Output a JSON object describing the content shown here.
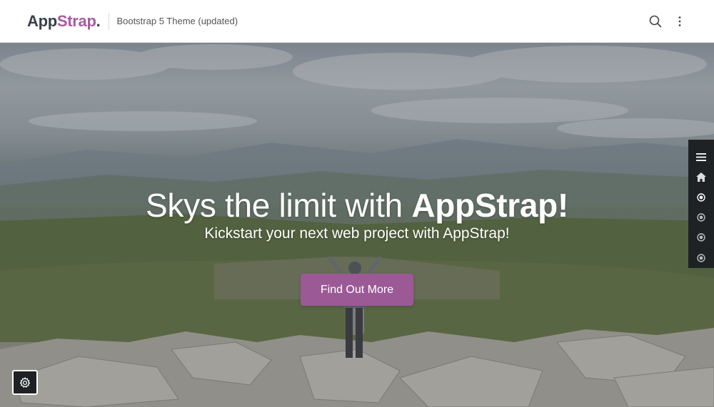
{
  "brand": {
    "part1": "App",
    "part2": "Strap",
    "part3": "."
  },
  "header": {
    "tagline": "Bootstrap 5 Theme (updated)"
  },
  "hero": {
    "headline_prefix": "Skys the limit with ",
    "headline_bold": "AppStrap!",
    "subhead": "Kickstart your next web project with AppStrap!",
    "cta_label": "Find Out More"
  },
  "sidenav": {
    "items": [
      {
        "icon": "menu-icon"
      },
      {
        "icon": "home-icon"
      },
      {
        "icon": "dot-icon",
        "active": true
      },
      {
        "icon": "dot-icon"
      },
      {
        "icon": "dot-icon"
      },
      {
        "icon": "dot-icon"
      }
    ]
  },
  "icons": {
    "search": "search-icon",
    "more": "more-vertical-icon",
    "settings": "gear-icon"
  },
  "colors": {
    "accent": "#9b5a95",
    "brand_accent": "#a95ba0",
    "dark": "#1f2225"
  }
}
